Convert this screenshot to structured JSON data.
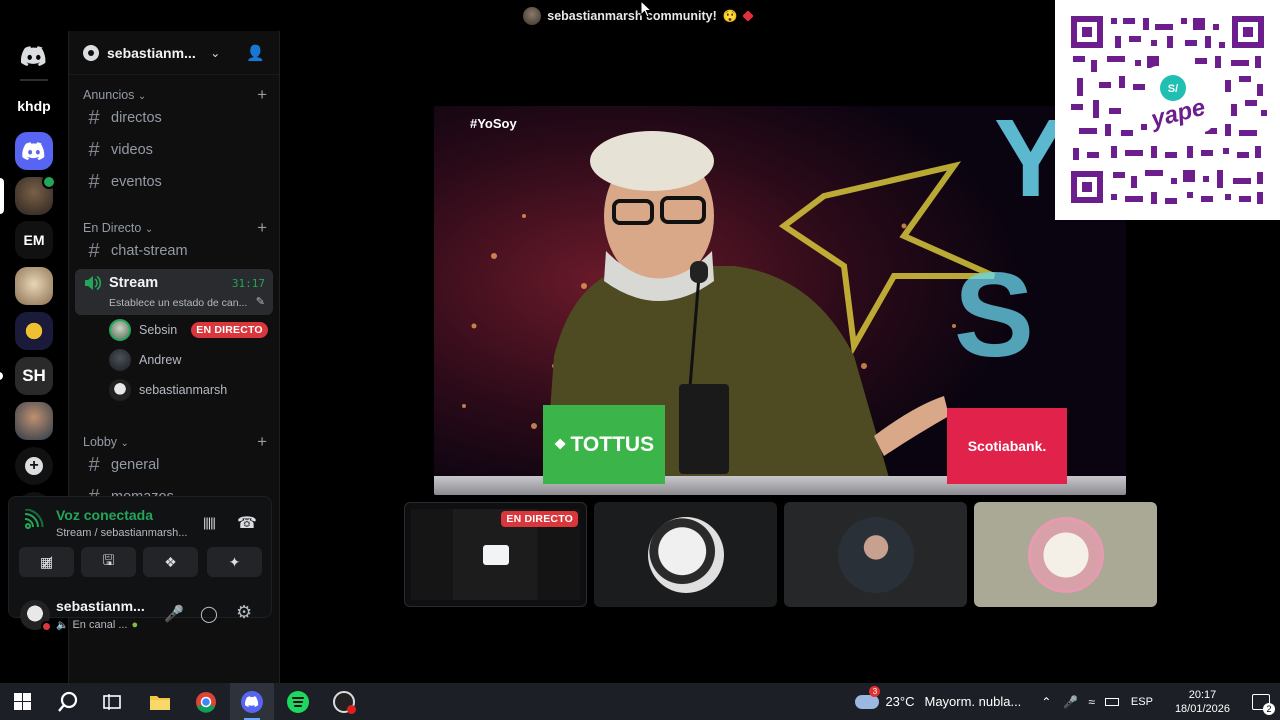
{
  "window": {
    "title": "sebastianmarsh community!",
    "title_emoji": "😲"
  },
  "server": {
    "name": "sebastianm..."
  },
  "rail": {
    "text_items": [
      "khdp",
      "EM",
      "SH"
    ]
  },
  "categories": [
    {
      "label": "Anuncios",
      "channels": [
        "directos",
        "videos",
        "eventos"
      ]
    },
    {
      "label": "En Directo",
      "channels": [
        "chat-stream"
      ]
    },
    {
      "label": "Lobby",
      "channels": [
        "general",
        "momazos"
      ]
    }
  ],
  "voice_channel": {
    "name": "Stream",
    "timer": "31:17",
    "status_placeholder": "Establece un estado de can...",
    "users": [
      {
        "name": "Sebsin",
        "badge": "EN DIRECTO"
      },
      {
        "name": "Andrew"
      },
      {
        "name": "sebastianmarsh"
      }
    ]
  },
  "voice_panel": {
    "status": "Voz conectada",
    "location": "Stream / sebastianmarsh..."
  },
  "user_panel": {
    "username": "sebastianm...",
    "status": "En canal ..."
  },
  "stream": {
    "hashtag": "#YoSoy",
    "sponsor_left": "TOTTUS",
    "sponsor_right": "Scotiabank."
  },
  "thumbnails": {
    "live_badge": "EN DIRECTO"
  },
  "qr": {
    "brand": "yape"
  },
  "taskbar": {
    "weather_temp": "23°C",
    "weather_desc": "Mayorm. nubla...",
    "weather_alert": "3",
    "language": "ESP",
    "time": "20:17",
    "date": "18/01/2026",
    "notifications": "2"
  },
  "colors": {
    "discord_blurple": "#5865f2",
    "voice_green": "#23a55a",
    "live_red": "#da373c",
    "yape_purple": "#6b1e8c",
    "tottus_green": "#3bb54a",
    "scotia_red": "#e1224b"
  }
}
